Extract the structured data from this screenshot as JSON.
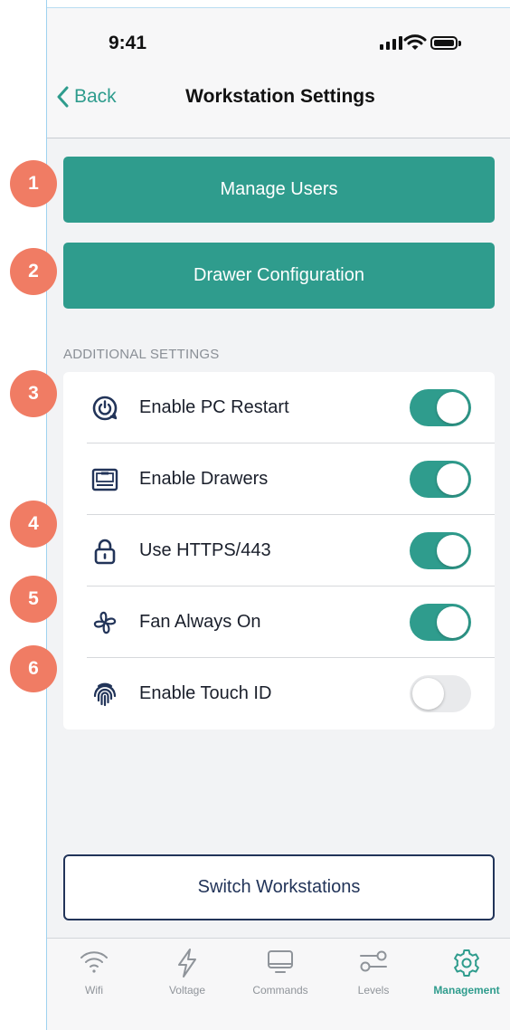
{
  "status_bar": {
    "time": "9:41"
  },
  "nav": {
    "back_label": "Back",
    "title": "Workstation Settings"
  },
  "actions": {
    "manage_users": "Manage Users",
    "drawer_configuration": "Drawer Configuration"
  },
  "additional_settings": {
    "section_label": "ADDITIONAL SETTINGS",
    "items": [
      {
        "label": "Enable PC Restart",
        "icon": "power-restart-icon",
        "enabled": true
      },
      {
        "label": "Enable Drawers",
        "icon": "drawer-icon",
        "enabled": true
      },
      {
        "label": "Use HTTPS/443",
        "icon": "lock-icon",
        "enabled": true
      },
      {
        "label": "Fan Always On",
        "icon": "fan-icon",
        "enabled": true
      },
      {
        "label": "Enable Touch ID",
        "icon": "fingerprint-icon",
        "enabled": false
      }
    ]
  },
  "switch_workstations": "Switch Workstations",
  "tabs": [
    {
      "label": "Wifi",
      "icon": "wifi-icon"
    },
    {
      "label": "Voltage",
      "icon": "lightning-icon"
    },
    {
      "label": "Commands",
      "icon": "monitor-icon"
    },
    {
      "label": "Levels",
      "icon": "sliders-icon"
    },
    {
      "label": "Management",
      "icon": "gear-icon",
      "active": true
    }
  ],
  "callouts": [
    "1",
    "2",
    "3",
    "4",
    "5",
    "6"
  ],
  "colors": {
    "accent": "#2f9c8d",
    "callout": "#f07c64",
    "navy": "#223459",
    "toggle_off": "#e9eaec"
  }
}
